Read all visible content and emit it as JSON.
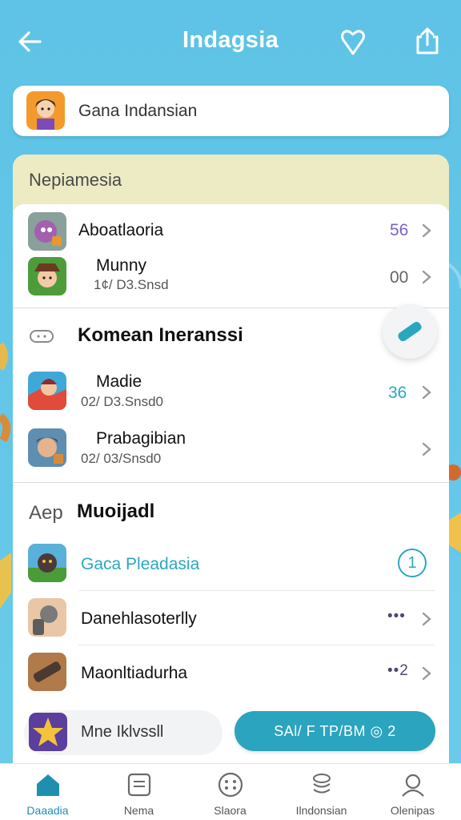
{
  "app": {
    "title": "Indagsia"
  },
  "game_bar": {
    "label": "Gana Indansian"
  },
  "section_header": "Nepiamesia",
  "list_a": [
    {
      "name": "Aboatlaoria",
      "sub": "",
      "value": "56",
      "value_color": "#7a63c9"
    },
    {
      "name": "Munny",
      "sub": "1¢/ D3.Snsd",
      "value": "00",
      "value_color": "#666666"
    }
  ],
  "group_b": {
    "title": "Komean Ineranssi"
  },
  "list_b": [
    {
      "name": "Madie",
      "sub": "02/ D3.Snsd0",
      "value": "36",
      "value_color": "#2aa7c0"
    },
    {
      "name": "Prabagibian",
      "sub": "02/ 03/Snsd0",
      "value": "",
      "value_color": "#666666"
    }
  ],
  "section_c": {
    "prefix": "Aep",
    "title": "Muoijadl"
  },
  "list_c": [
    {
      "name": "Gaca Pleadasia",
      "name_color": "#2aa7c0",
      "badge": "1"
    },
    {
      "name": "Danehlasoterlly",
      "name_color": "#111111",
      "value": "•••"
    },
    {
      "name": "Maonltiadurha",
      "name_color": "#111111",
      "value": "••2"
    }
  ],
  "bottom": {
    "pill_label": "Mne Iklvssll",
    "cta_label": "SAl/ F TP/BM ◎ 2"
  },
  "tabs": [
    {
      "label": "Daaadia",
      "icon": "home-icon",
      "active": true
    },
    {
      "label": "Nema",
      "icon": "notes-icon",
      "active": false
    },
    {
      "label": "Slaora",
      "icon": "grid-dots-icon",
      "active": false
    },
    {
      "label": "Ilndonsian",
      "icon": "stack-icon",
      "active": false
    },
    {
      "label": "Olenipas",
      "icon": "profile-icon",
      "active": false
    }
  ]
}
